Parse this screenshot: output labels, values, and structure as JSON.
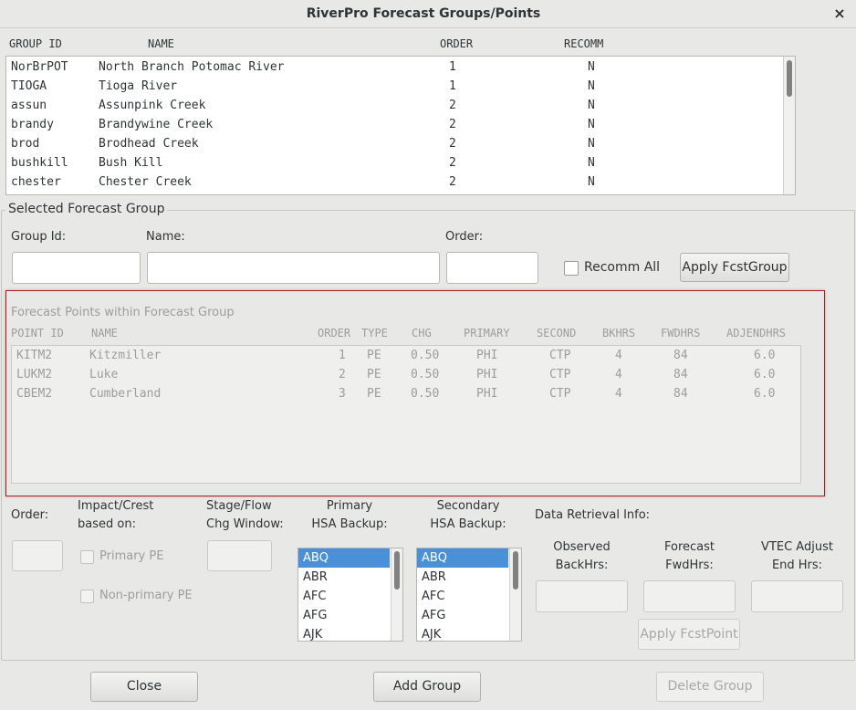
{
  "window": {
    "title": "RiverPro Forecast Groups/Points",
    "close_icon": "×"
  },
  "groups_table": {
    "headers": [
      "GROUP ID",
      "NAME",
      "ORDER",
      "RECOMM"
    ],
    "rows": [
      [
        "NorBrPOT",
        "North Branch Potomac River",
        "1",
        "N"
      ],
      [
        "TIOGA",
        "Tioga River",
        "1",
        "N"
      ],
      [
        "assun",
        "Assunpink Creek",
        "2",
        "N"
      ],
      [
        "brandy",
        "Brandywine Creek",
        "2",
        "N"
      ],
      [
        "brod",
        "Brodhead Creek",
        "2",
        "N"
      ],
      [
        "bushkill",
        "Bush Kill",
        "2",
        "N"
      ],
      [
        "chester",
        "Chester Creek",
        "2",
        "N"
      ]
    ]
  },
  "selected_group": {
    "legend": "Selected Forecast Group",
    "group_id_label": "Group Id:",
    "name_label": "Name:",
    "order_label": "Order:",
    "group_id_value": "",
    "name_value": "",
    "order_value": "",
    "recomm_all_label": "Recomm All",
    "apply_label": "Apply FcstGroup"
  },
  "points": {
    "legend": "Forecast Points within Forecast Group",
    "headers": [
      "POINT ID",
      "NAME",
      "ORDER",
      "TYPE",
      "CHG",
      "PRIMARY",
      "SECOND",
      "BKHRS",
      "FWDHRS",
      "ADJENDHRS"
    ],
    "rows": [
      [
        "KITM2",
        "Kitzmiller",
        "1",
        "PE",
        "0.50",
        "PHI",
        "CTP",
        "4",
        "84",
        "6.0"
      ],
      [
        "LUKM2",
        "Luke",
        "2",
        "PE",
        "0.50",
        "PHI",
        "CTP",
        "4",
        "84",
        "6.0"
      ],
      [
        "CBEM2",
        "Cumberland",
        "3",
        "PE",
        "0.50",
        "PHI",
        "CTP",
        "4",
        "84",
        "6.0"
      ]
    ]
  },
  "point_edit": {
    "order_label": "Order:",
    "impact_label_1": "Impact/Crest",
    "impact_label_2": "based on:",
    "primary_pe_label": "Primary PE",
    "nonprimary_pe_label": "Non-primary PE",
    "chg_label_1": "Stage/Flow",
    "chg_label_2": "Chg Window:",
    "primary_hsa_label_1": "Primary",
    "primary_hsa_label_2": "HSA Backup:",
    "secondary_hsa_label_1": "Secondary",
    "secondary_hsa_label_2": "HSA Backup:",
    "hsa_options": [
      "ABQ",
      "ABR",
      "AFC",
      "AFG",
      "AJK"
    ],
    "primary_selected": "ABQ",
    "secondary_selected": "ABQ",
    "data_retrieval_label": "Data Retrieval Info:",
    "observed_label_1": "Observed",
    "observed_label_2": "BackHrs:",
    "forecast_label_1": "Forecast",
    "forecast_label_2": "FwdHrs:",
    "vtec_label_1": "VTEC Adjust",
    "vtec_label_2": "End Hrs:",
    "apply_point_label": "Apply FcstPoint"
  },
  "footer": {
    "close_label": "Close",
    "add_group_label": "Add Group",
    "delete_group_label": "Delete Group"
  },
  "colors": {
    "accent_red": "#a52121",
    "selection_blue": "#4a90d9"
  }
}
